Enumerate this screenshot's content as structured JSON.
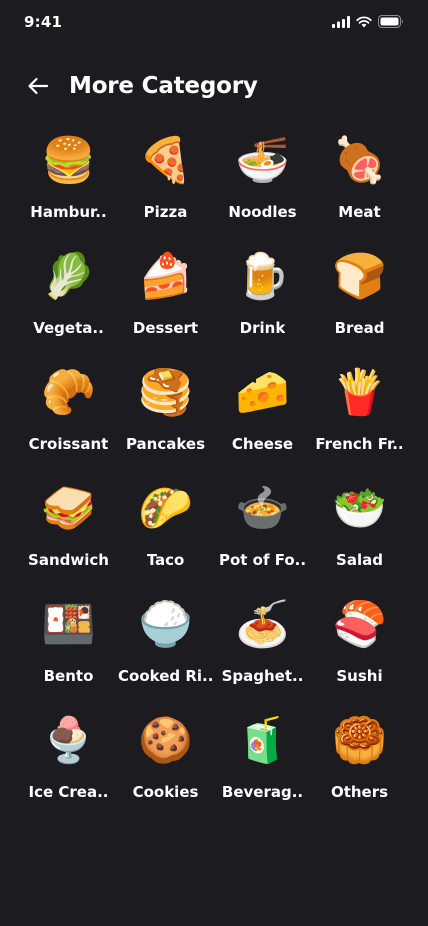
{
  "status": {
    "time": "9:41"
  },
  "header": {
    "title": "More Category",
    "back_icon": "arrow-left-icon"
  },
  "categories": [
    {
      "label": "Hambur..",
      "emoji": "🍔",
      "icon": "hamburger-icon"
    },
    {
      "label": "Pizza",
      "emoji": "🍕",
      "icon": "pizza-icon"
    },
    {
      "label": "Noodles",
      "emoji": "🍜",
      "icon": "noodles-icon"
    },
    {
      "label": "Meat",
      "emoji": "🍖",
      "icon": "meat-icon"
    },
    {
      "label": "Vegeta..",
      "emoji": "🥬",
      "icon": "vegetable-icon"
    },
    {
      "label": "Dessert",
      "emoji": "🍰",
      "icon": "dessert-icon"
    },
    {
      "label": "Drink",
      "emoji": "🍺",
      "icon": "drink-icon"
    },
    {
      "label": "Bread",
      "emoji": "🍞",
      "icon": "bread-icon"
    },
    {
      "label": "Croissant",
      "emoji": "🥐",
      "icon": "croissant-icon"
    },
    {
      "label": "Pancakes",
      "emoji": "🥞",
      "icon": "pancakes-icon"
    },
    {
      "label": "Cheese",
      "emoji": "🧀",
      "icon": "cheese-icon"
    },
    {
      "label": "French Fr..",
      "emoji": "🍟",
      "icon": "french-fries-icon"
    },
    {
      "label": "Sandwich",
      "emoji": "🥪",
      "icon": "sandwich-icon"
    },
    {
      "label": "Taco",
      "emoji": "🌮",
      "icon": "taco-icon"
    },
    {
      "label": "Pot of Fo..",
      "emoji": "🍲",
      "icon": "pot-of-food-icon"
    },
    {
      "label": "Salad",
      "emoji": "🥗",
      "icon": "salad-icon"
    },
    {
      "label": "Bento",
      "emoji": "🍱",
      "icon": "bento-icon"
    },
    {
      "label": "Cooked Ri..",
      "emoji": "🍚",
      "icon": "cooked-rice-icon"
    },
    {
      "label": "Spaghet..",
      "emoji": "🍝",
      "icon": "spaghetti-icon"
    },
    {
      "label": "Sushi",
      "emoji": "🍣",
      "icon": "sushi-icon"
    },
    {
      "label": "Ice Crea..",
      "emoji": "🍨",
      "icon": "ice-cream-icon"
    },
    {
      "label": "Cookies",
      "emoji": "🍪",
      "icon": "cookies-icon"
    },
    {
      "label": "Beverag..",
      "emoji": "🧃",
      "icon": "beverage-icon"
    },
    {
      "label": "Others",
      "emoji": "🥮",
      "icon": "others-icon"
    }
  ],
  "colors": {
    "background": "#1c1b20",
    "text": "#ffffff"
  }
}
